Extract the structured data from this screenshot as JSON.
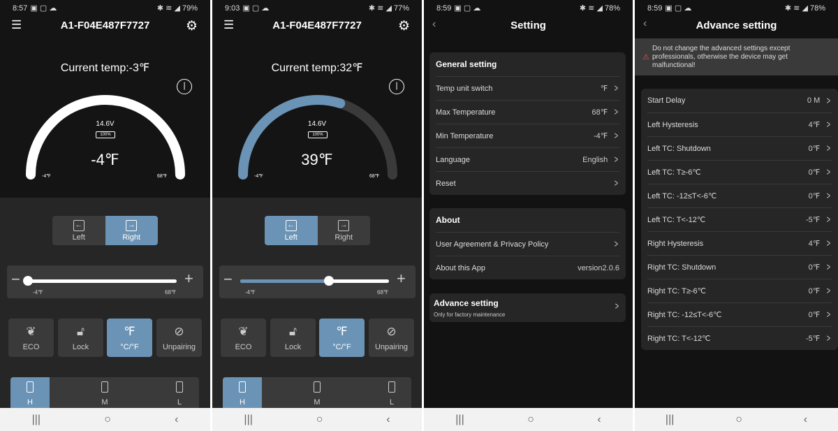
{
  "colors": {
    "accent": "#6a93b6",
    "background": "#141414",
    "card": "#262626",
    "warning": "#e05555"
  },
  "screens": [
    {
      "status": {
        "time": "8:57",
        "badge": "79",
        "battery": "79%"
      },
      "title": "A1-F04E487F7727",
      "current_temp": "Current temp:-3℉",
      "voltage": "14.6V",
      "battery_level": "100%",
      "set_temp": "-4℉",
      "set_value": -4,
      "range_min": "-4℉",
      "range_max": "68℉",
      "min": -4,
      "max": 68,
      "zone": {
        "left": "Left",
        "right": "Right",
        "active": "right"
      },
      "buttons": [
        {
          "label": "ECO",
          "icon": "leaf-icon"
        },
        {
          "label": "Lock",
          "icon": "lock-icon"
        },
        {
          "label": "°C/°F",
          "icon": "fahrenheit-icon",
          "active": true
        },
        {
          "label": "Unpairing",
          "icon": "link-icon"
        }
      ],
      "power_modes": {
        "h": "H",
        "m": "M",
        "l": "L",
        "active": "H"
      }
    },
    {
      "status": {
        "time": "9:03",
        "badge": "",
        "battery": "77%"
      },
      "title": "A1-F04E487F7727",
      "current_temp": "Current temp:32℉",
      "voltage": "14.6V",
      "battery_level": "100%",
      "set_temp": "39℉",
      "set_value": 39,
      "range_min": "-4℉",
      "range_max": "68℉",
      "min": -4,
      "max": 68,
      "zone": {
        "left": "Left",
        "right": "Right",
        "active": "left"
      },
      "buttons": [
        {
          "label": "ECO",
          "icon": "leaf-icon"
        },
        {
          "label": "Lock",
          "icon": "lock-icon"
        },
        {
          "label": "°C/°F",
          "icon": "fahrenheit-icon",
          "active": true
        },
        {
          "label": "Unpairing",
          "icon": "link-icon"
        }
      ],
      "power_modes": {
        "h": "H",
        "m": "M",
        "l": "L",
        "active": "H"
      }
    }
  ],
  "settings": {
    "status": {
      "time": "8:59",
      "badge": "78",
      "battery": "78%"
    },
    "title": "Setting",
    "general": {
      "title": "General setting",
      "rows": [
        {
          "label": "Temp unit switch",
          "value": "℉"
        },
        {
          "label": "Max Temperature",
          "value": "68℉"
        },
        {
          "label": "Min Temperature",
          "value": "-4℉"
        },
        {
          "label": "Language",
          "value": "English"
        },
        {
          "label": "Reset",
          "value": ""
        }
      ]
    },
    "about": {
      "title": "About",
      "rows": [
        {
          "label": "User Agreement & Privacy Policy",
          "value": ""
        },
        {
          "label": "About this App",
          "value": "version2.0.6"
        }
      ]
    },
    "advance": {
      "title": "Advance setting",
      "subtitle": "Only for factory maintenance"
    }
  },
  "advance": {
    "status": {
      "time": "8:59",
      "badge": "78",
      "battery": "78%"
    },
    "title": "Advance setting",
    "warning": "Do not change the advanced settings except professionals, otherwise the device may get malfunctional!",
    "rows": [
      {
        "label": "Start Delay",
        "value": "0 M"
      },
      {
        "label": "Left Hysteresis",
        "value": "4℉"
      },
      {
        "label": "Left TC: Shutdown",
        "value": "0℉"
      },
      {
        "label": "Left TC: T≥-6℃",
        "value": "0℉"
      },
      {
        "label": "Left TC: -12≤T<-6℃",
        "value": "0℉"
      },
      {
        "label": "Left TC: T<-12℃",
        "value": "-5℉"
      },
      {
        "label": "Right Hysteresis",
        "value": "4℉"
      },
      {
        "label": "Right TC: Shutdown",
        "value": "0℉"
      },
      {
        "label": "Right TC: T≥-6℃",
        "value": "0℉"
      },
      {
        "label": "Right TC: -12≤T<-6℃",
        "value": "0℉"
      },
      {
        "label": "Right TC: T<-12℃",
        "value": "-5℉"
      }
    ]
  }
}
